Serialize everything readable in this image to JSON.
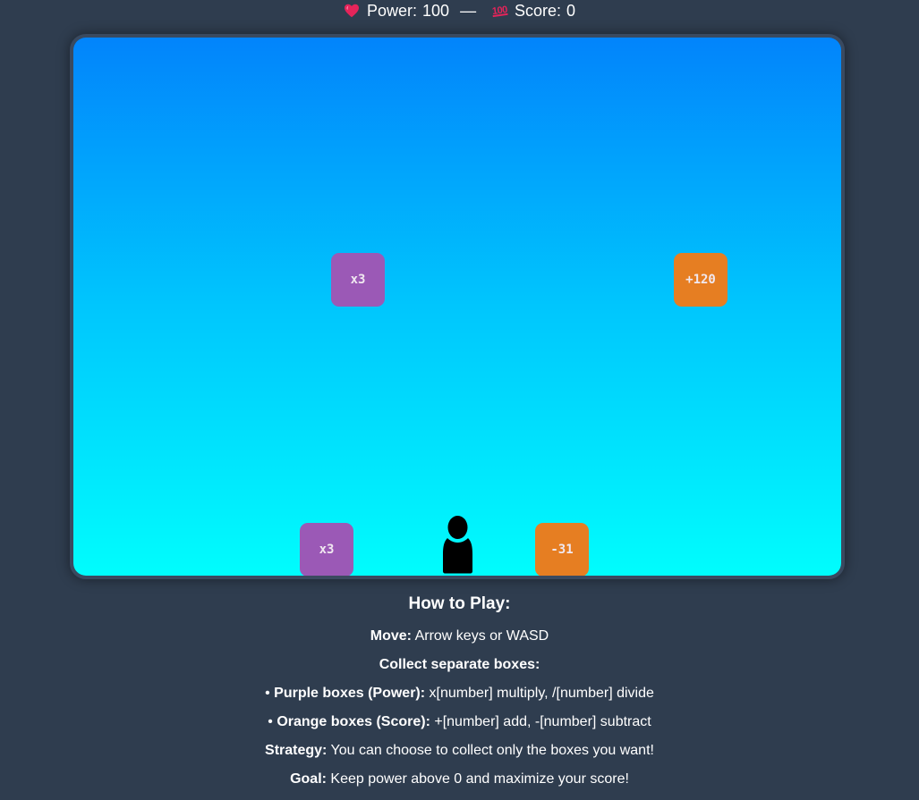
{
  "hud": {
    "power_label": "Power:",
    "power_value": "100",
    "separator": "—",
    "score_label": "Score:",
    "score_value": "0",
    "power_icon": "heart-icon",
    "score_icon": "hundred-points-icon"
  },
  "game": {
    "background_top": "#0284fb",
    "background_bottom": "#00fdfd",
    "boxes": [
      {
        "label": "x3",
        "kind": "power",
        "color": "#9b59b6"
      },
      {
        "label": "+120",
        "kind": "score",
        "color": "#e67e22"
      },
      {
        "label": "x3",
        "kind": "power",
        "color": "#9b59b6"
      },
      {
        "label": "-31",
        "kind": "score",
        "color": "#e67e22"
      }
    ],
    "player_icon": "person-silhouette-icon"
  },
  "instructions": {
    "title": "How to Play:",
    "move_label": "Move:",
    "move_text": " Arrow keys or WASD",
    "collect_label": "Collect separate boxes:",
    "purple_bullet": "• ",
    "purple_label": "Purple boxes (Power):",
    "purple_text": " x[number] multiply, /[number] divide",
    "orange_bullet": "• ",
    "orange_label": "Orange boxes (Score):",
    "orange_text": " +[number] add, -[number] subtract",
    "strategy_label": "Strategy:",
    "strategy_text": " You can choose to collect only the boxes you want!",
    "goal_label": "Goal:",
    "goal_text": " Keep power above 0 and maximize your score!"
  }
}
